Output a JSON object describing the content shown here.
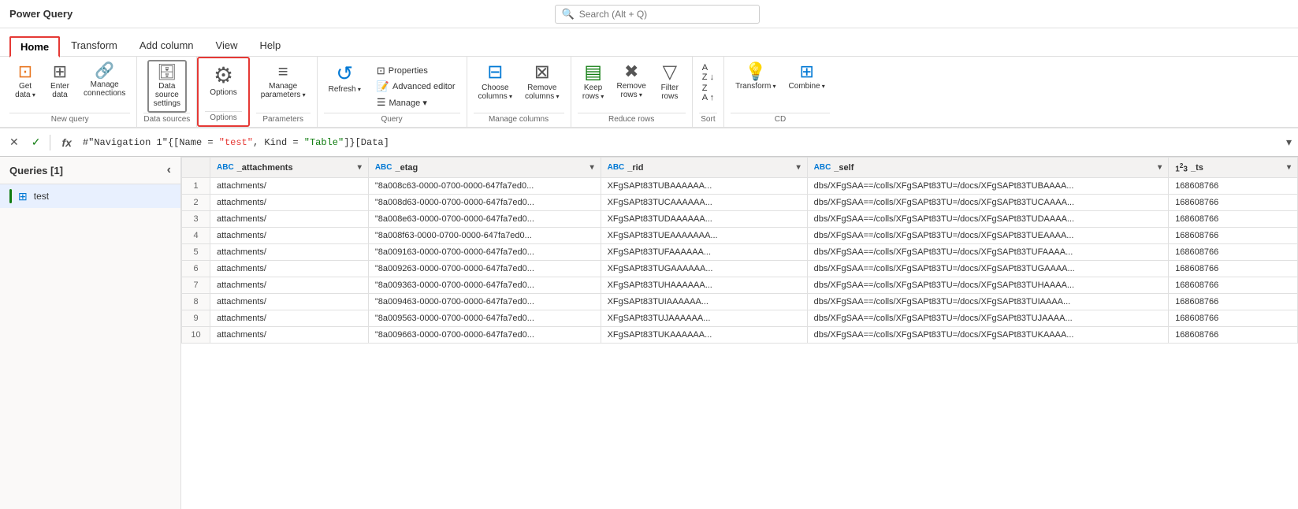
{
  "titleBar": {
    "title": "Power Query",
    "searchPlaceholder": "Search (Alt + Q)"
  },
  "tabs": {
    "items": [
      "Home",
      "Transform",
      "Add column",
      "View",
      "Help"
    ],
    "active": "Home"
  },
  "ribbon": {
    "groups": [
      {
        "label": "New query",
        "buttons": [
          {
            "id": "get-data",
            "icon": "table",
            "label": "Get\ndata",
            "dropdown": true
          },
          {
            "id": "enter-data",
            "icon": "enter",
            "label": "Enter\ndata",
            "dropdown": false
          },
          {
            "id": "manage-conn",
            "icon": "conn",
            "label": "Manage\nconnections",
            "dropdown": false
          }
        ]
      },
      {
        "label": "Options",
        "buttons": [
          {
            "id": "options",
            "icon": "options",
            "label": "Options",
            "dropdown": false,
            "highlighted": true
          }
        ]
      },
      {
        "label": "Parameters",
        "buttons": [
          {
            "id": "manage-params",
            "icon": "params",
            "label": "Manage\nparameters",
            "dropdown": true
          }
        ]
      },
      {
        "label": "Query",
        "buttons": [
          {
            "id": "refresh",
            "icon": "refresh",
            "label": "Refresh",
            "dropdown": true
          },
          {
            "id": "properties",
            "icon": "props",
            "label": "Properties",
            "small": true
          },
          {
            "id": "advanced-editor",
            "icon": "adv",
            "label": "Advanced editor",
            "small": true
          },
          {
            "id": "manage",
            "icon": "manage",
            "label": "Manage",
            "small": true,
            "dropdown": true
          }
        ]
      },
      {
        "label": "Manage columns",
        "buttons": [
          {
            "id": "choose-columns",
            "icon": "choose-col",
            "label": "Choose\ncolumns",
            "dropdown": true
          },
          {
            "id": "remove-columns",
            "icon": "remove-col",
            "label": "Remove\ncolumns",
            "dropdown": true
          }
        ]
      },
      {
        "label": "Reduce rows",
        "buttons": [
          {
            "id": "keep-rows",
            "icon": "keep-rows",
            "label": "Keep\nrows",
            "dropdown": true
          },
          {
            "id": "remove-rows",
            "icon": "remove-rows",
            "label": "Remove\nrows",
            "dropdown": true
          },
          {
            "id": "filter-rows",
            "icon": "filter",
            "label": "Filter\nrows",
            "dropdown": false
          }
        ]
      },
      {
        "label": "Sort",
        "buttons": [
          {
            "id": "sort",
            "icon": "sort",
            "label": "",
            "dropdown": false
          }
        ]
      },
      {
        "label": "",
        "buttons": [
          {
            "id": "transform",
            "icon": "transform",
            "label": "Transform",
            "dropdown": true
          },
          {
            "id": "combine",
            "icon": "combine",
            "label": "Combine",
            "dropdown": true
          }
        ]
      }
    ]
  },
  "formulaBar": {
    "formula": "#\"Navigation 1\"{[Name = \"test\", Kind = \"Table\"]}[Data]",
    "formulaDisplay": "#\"Navigation 1\"{[Name = \"test\", Kind = \"Table\"]}[Data]"
  },
  "sidebar": {
    "title": "Queries [1]",
    "queries": [
      {
        "name": "test",
        "type": "table"
      }
    ]
  },
  "grid": {
    "columns": [
      {
        "name": "_attachments",
        "type": "ABC"
      },
      {
        "name": "_etag",
        "type": "ABC"
      },
      {
        "name": "_rid",
        "type": "ABC"
      },
      {
        "name": "_self",
        "type": "ABC"
      },
      {
        "name": "_ts",
        "type": "123"
      }
    ],
    "rows": [
      [
        "attachments/",
        "\"8a008c63-0000-0700-0000-647fa7ed0...",
        "XFgSAPt83TUBAAAAAA...",
        "dbs/XFgSAA==/colls/XFgSAPt83TU=/docs/XFgSAPt83TUBAAAA...",
        "168608766"
      ],
      [
        "attachments/",
        "\"8a008d63-0000-0700-0000-647fa7ed0...",
        "XFgSAPt83TUCAAAAAA...",
        "dbs/XFgSAA==/colls/XFgSAPt83TU=/docs/XFgSAPt83TUCAAAA...",
        "168608766"
      ],
      [
        "attachments/",
        "\"8a008e63-0000-0700-0000-647fa7ed0...",
        "XFgSAPt83TUDAAAAAA...",
        "dbs/XFgSAA==/colls/XFgSAPt83TU=/docs/XFgSAPt83TUDAAAA...",
        "168608766"
      ],
      [
        "attachments/",
        "\"8a008f63-0000-0700-0000-647fa7ed0...",
        "XFgSAPt83TUEAAAAAAA...",
        "dbs/XFgSAA==/colls/XFgSAPt83TU=/docs/XFgSAPt83TUEAAAA...",
        "168608766"
      ],
      [
        "attachments/",
        "\"8a009163-0000-0700-0000-647fa7ed0...",
        "XFgSAPt83TUFAAAAAA...",
        "dbs/XFgSAA==/colls/XFgSAPt83TU=/docs/XFgSAPt83TUFAAAA...",
        "168608766"
      ],
      [
        "attachments/",
        "\"8a009263-0000-0700-0000-647fa7ed0...",
        "XFgSAPt83TUGAAAAAA...",
        "dbs/XFgSAA==/colls/XFgSAPt83TU=/docs/XFgSAPt83TUGAAAA...",
        "168608766"
      ],
      [
        "attachments/",
        "\"8a009363-0000-0700-0000-647fa7ed0...",
        "XFgSAPt83TUHAAAAAA...",
        "dbs/XFgSAA==/colls/XFgSAPt83TU=/docs/XFgSAPt83TUHAAAA...",
        "168608766"
      ],
      [
        "attachments/",
        "\"8a009463-0000-0700-0000-647fa7ed0...",
        "XFgSAPt83TUIAAAAAA...",
        "dbs/XFgSAA==/colls/XFgSAPt83TU=/docs/XFgSAPt83TUIAAAA...",
        "168608766"
      ],
      [
        "attachments/",
        "\"8a009563-0000-0700-0000-647fa7ed0...",
        "XFgSAPt83TUJAAAAAA...",
        "dbs/XFgSAA==/colls/XFgSAPt83TU=/docs/XFgSAPt83TUJAAAA...",
        "168608766"
      ],
      [
        "attachments/",
        "\"8a009663-0000-0700-0000-647fa7ed0...",
        "XFgSAPt83TUKAAAAAA...",
        "dbs/XFgSAA==/colls/XFgSAPt83TU=/docs/XFgSAPt83TUKAAAA...",
        "168608766"
      ]
    ]
  }
}
